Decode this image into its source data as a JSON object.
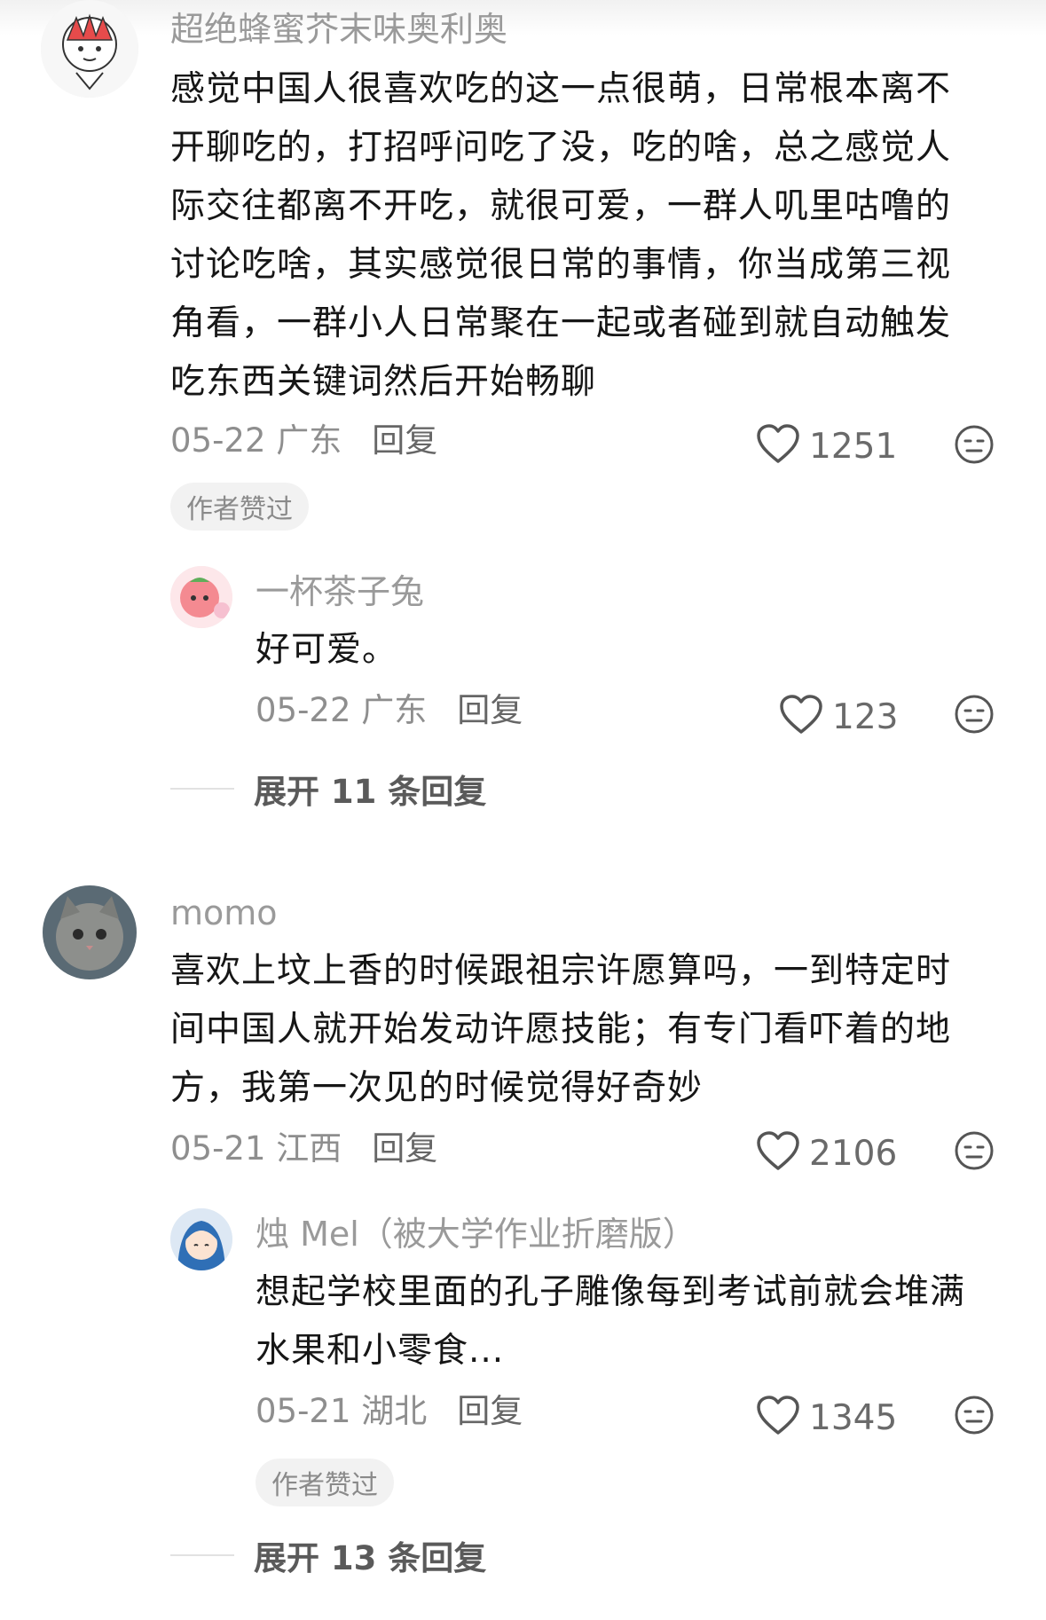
{
  "comments": [
    {
      "username": "超绝蜂蜜芥末味奥利奥",
      "text": "感觉中国人很喜欢吃的这一点很萌，日常根本离不开聊吃的，打招呼问吃了没，吃的啥，总之感觉人际交往都离不开吃，就很可爱，一群人叽里咕噜的讨论吃啥，其实感觉很日常的事情，你当成第三视角看，一群小人日常聚在一起或者碰到就自动触发吃东西关键词然后开始畅聊",
      "date": "05-22",
      "location": "广东",
      "reply_label": "回复",
      "likes": "1251",
      "badge": "作者赞过",
      "replies": [
        {
          "username": "一杯茶子兔",
          "text": "好可爱。",
          "date": "05-22",
          "location": "广东",
          "reply_label": "回复",
          "likes": "123"
        }
      ],
      "expand_label": "展开 11 条回复"
    },
    {
      "username": "momo",
      "text": "喜欢上坟上香的时候跟祖宗许愿算吗，一到特定时间中国人就开始发动许愿技能；有专门看吓着的地方，我第一次见的时候觉得好奇妙",
      "date": "05-21",
      "location": "江西",
      "reply_label": "回复",
      "likes": "2106",
      "replies": [
        {
          "username": "烛 Mel（被大学作业折磨版）",
          "text": "想起学校里面的孔子雕像每到考试前就会堆满水果和小零食...",
          "date": "05-21",
          "location": "湖北",
          "reply_label": "回复",
          "likes": "1345",
          "badge": "作者赞过"
        }
      ],
      "expand_label": "展开 13 条回复"
    }
  ],
  "icons": {
    "like": "heart-outline-icon",
    "dislike": "meh-face-icon"
  },
  "colors": {
    "text": "#161616",
    "muted": "#9a9a9a",
    "badge_bg": "#f2f2f2"
  }
}
